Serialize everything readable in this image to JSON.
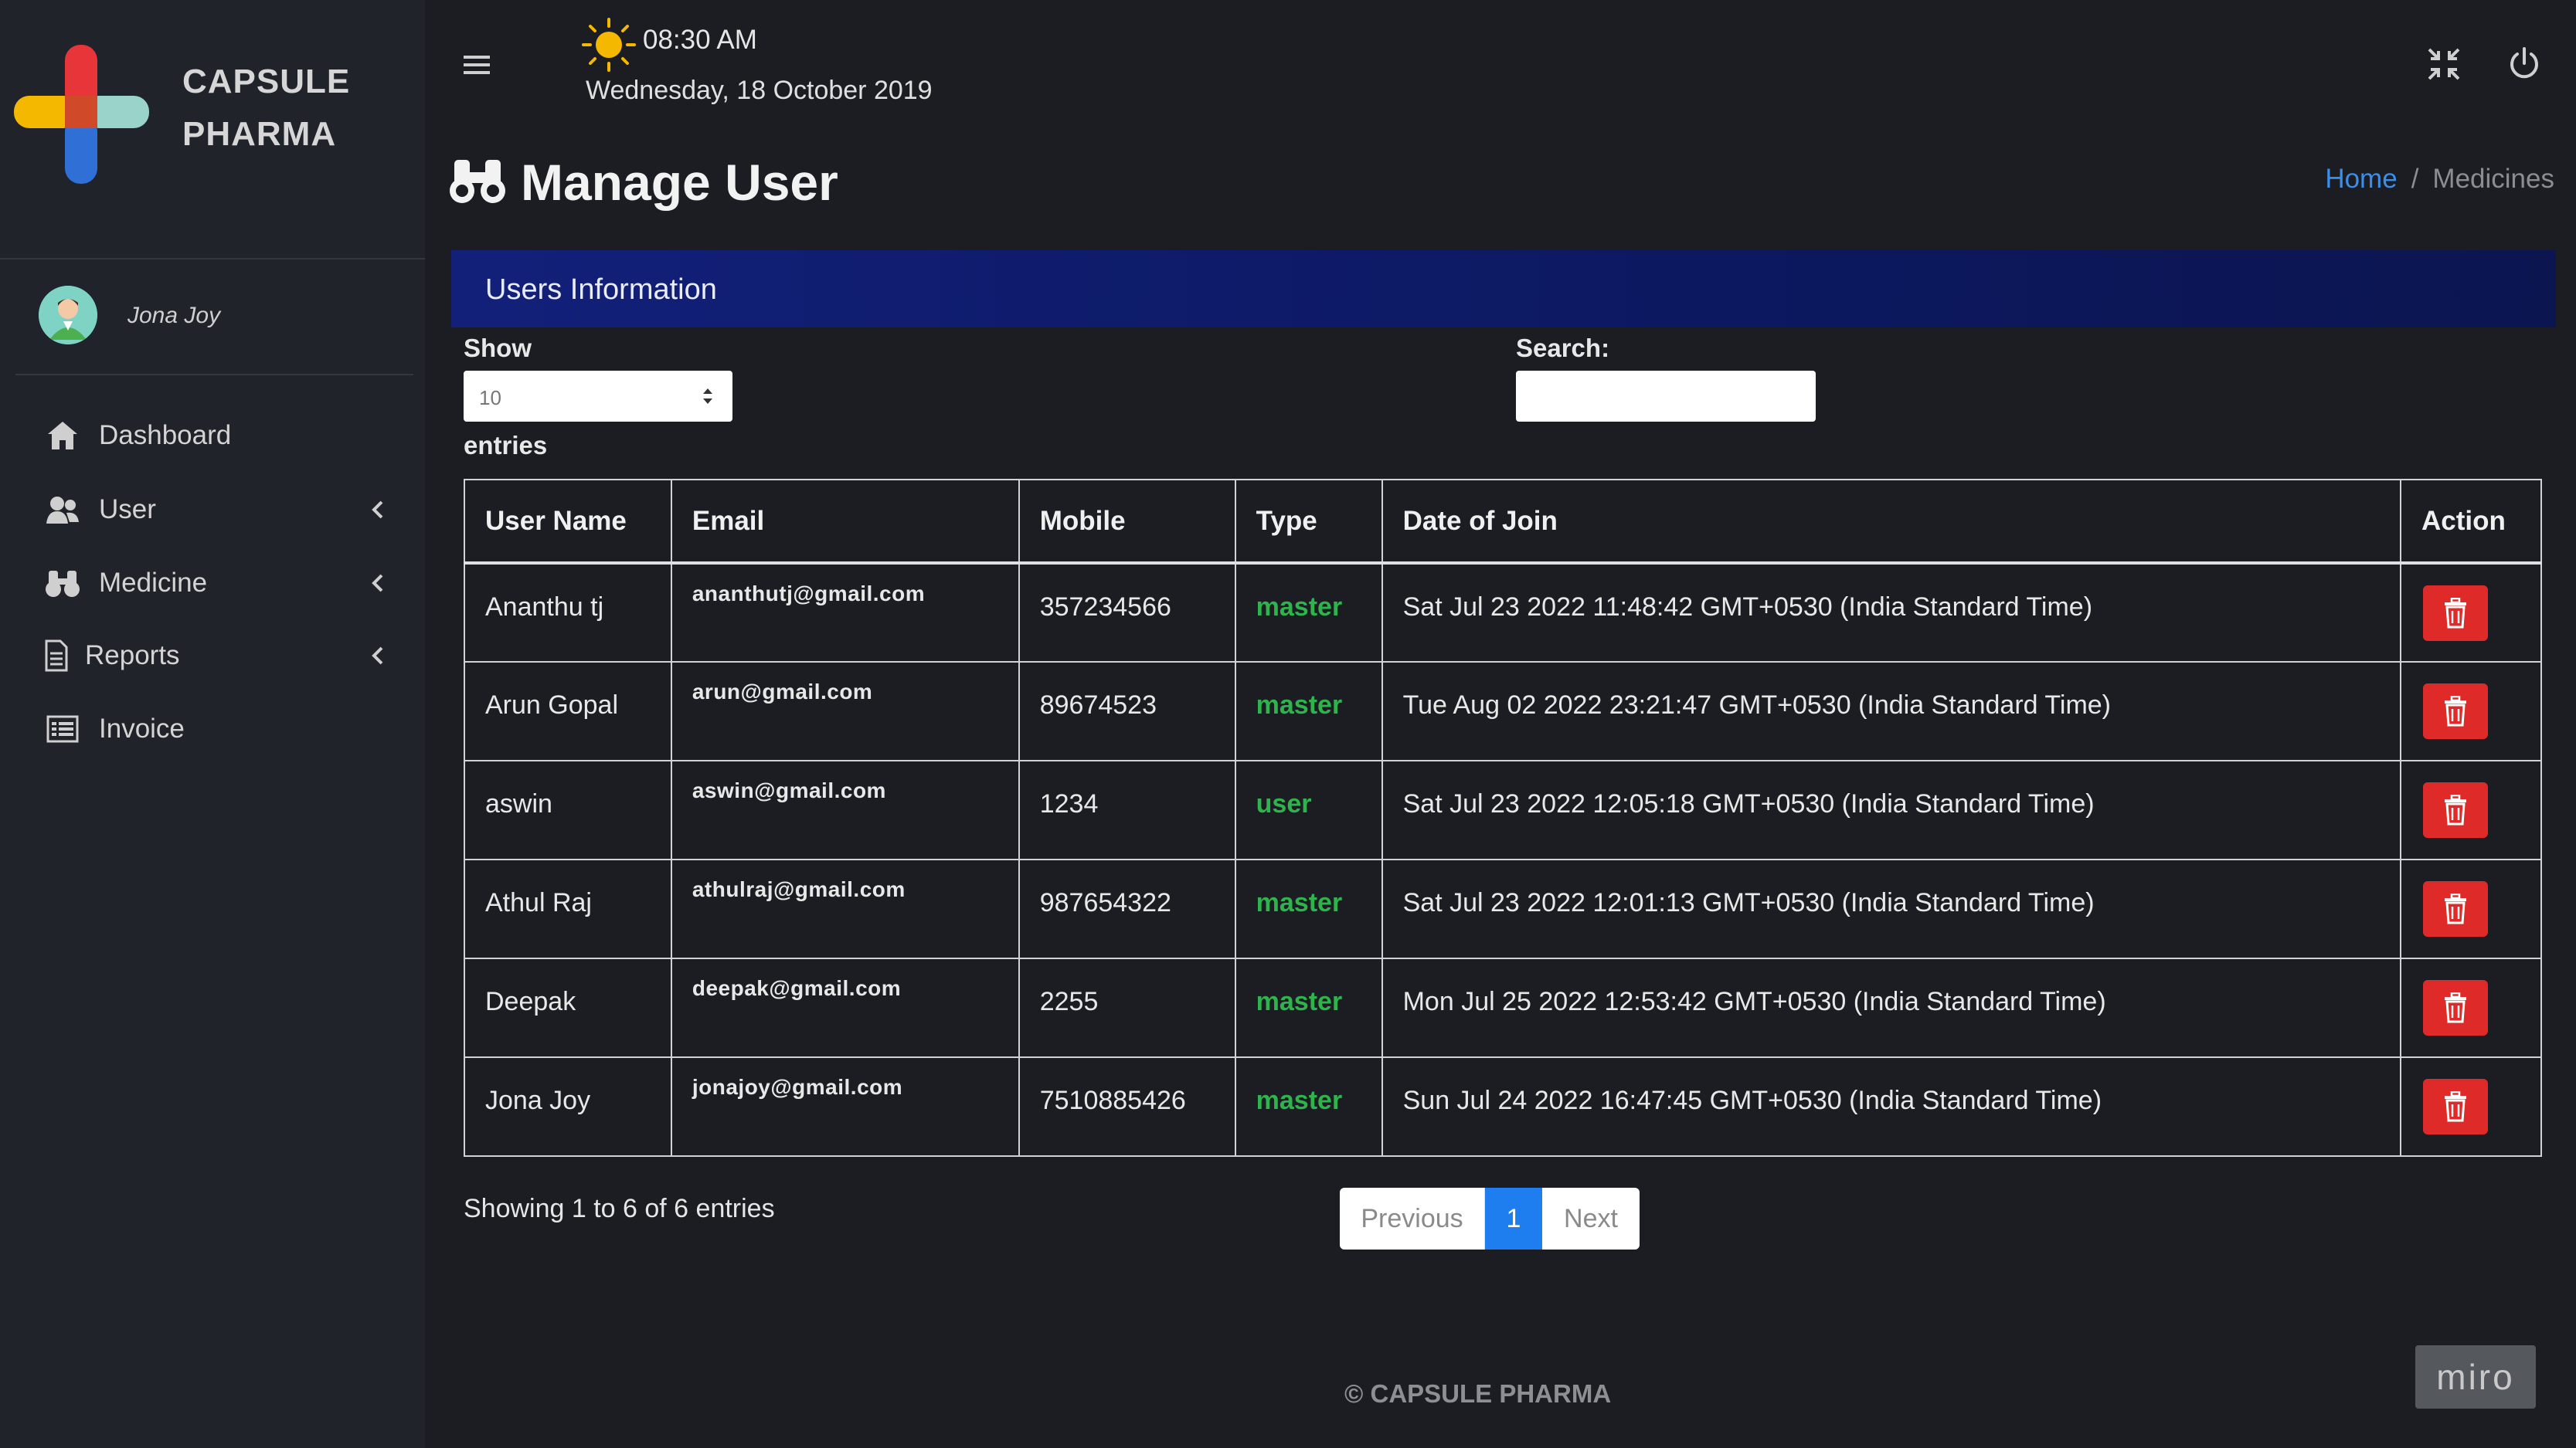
{
  "brand": {
    "name": "CAPSULE PHARMA",
    "colors": {
      "red": "#e8353a",
      "blue": "#2f6fd6",
      "yellow": "#f5b800",
      "teal": "#9ad3c9"
    }
  },
  "user": {
    "name": "Jona Joy"
  },
  "sidebar": {
    "items": [
      {
        "label": "Dashboard",
        "icon": "home-icon",
        "has_submenu": false
      },
      {
        "label": "User",
        "icon": "users-icon",
        "has_submenu": true
      },
      {
        "label": "Medicine",
        "icon": "binoculars-icon",
        "has_submenu": true
      },
      {
        "label": "Reports",
        "icon": "file-icon",
        "has_submenu": true
      },
      {
        "label": "Invoice",
        "icon": "list-icon",
        "has_submenu": false
      }
    ]
  },
  "topbar": {
    "time": "08:30 AM",
    "date": "Wednesday, 18 October 2019"
  },
  "page": {
    "title": "Manage User"
  },
  "breadcrumb": {
    "home": "Home",
    "separator": "/",
    "current": "Medicines"
  },
  "card": {
    "title": "Users Information"
  },
  "controls": {
    "show_label": "Show",
    "entries_value": "10",
    "entries_label": "entries",
    "search_label": "Search:",
    "search_value": ""
  },
  "table": {
    "headers": [
      "User Name",
      "Email",
      "Mobile",
      "Type",
      "Date of Join",
      "Action"
    ],
    "rows": [
      {
        "name": "Ananthu tj",
        "email": "ananthutj@gmail.com",
        "mobile": "357234566",
        "type": "master",
        "joined": "Sat Jul 23 2022 11:48:42 GMT+0530 (India Standard Time)"
      },
      {
        "name": "Arun Gopal",
        "email": "arun@gmail.com",
        "mobile": "89674523",
        "type": "master",
        "joined": "Tue Aug 02 2022 23:21:47 GMT+0530 (India Standard Time)"
      },
      {
        "name": "aswin",
        "email": "aswin@gmail.com",
        "mobile": "1234",
        "type": "user",
        "joined": "Sat Jul 23 2022 12:05:18 GMT+0530 (India Standard Time)"
      },
      {
        "name": "Athul Raj",
        "email": "athulraj@gmail.com",
        "mobile": "987654322",
        "type": "master",
        "joined": "Sat Jul 23 2022 12:01:13 GMT+0530 (India Standard Time)"
      },
      {
        "name": "Deepak",
        "email": "deepak@gmail.com",
        "mobile": "2255",
        "type": "master",
        "joined": "Mon Jul 25 2022 12:53:42 GMT+0530 (India Standard Time)"
      },
      {
        "name": "Jona Joy",
        "email": "jonajoy@gmail.com",
        "mobile": "7510885426",
        "type": "master",
        "joined": "Sun Jul 24 2022 16:47:45 GMT+0530 (India Standard Time)"
      }
    ]
  },
  "table_info": {
    "text": "Showing 1 to 6 of 6 entries"
  },
  "pagination": {
    "previous": "Previous",
    "current": "1",
    "next": "Next"
  },
  "footer": {
    "text": "© CAPSULE PHARMA"
  },
  "watermark": {
    "text": "miro"
  },
  "colors": {
    "accent": "#1e7ef0",
    "danger": "#df2a2a",
    "type_text": "#2fb34c",
    "header_bar": "#12207a"
  }
}
